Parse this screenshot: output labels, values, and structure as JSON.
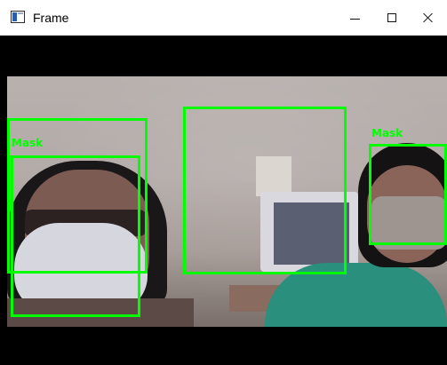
{
  "window": {
    "title": "Frame"
  },
  "controls": {
    "minimize": "minimize",
    "maximize": "maximize",
    "close": "close"
  },
  "detections": [
    {
      "label": "Mask"
    },
    {
      "label": "Mask"
    }
  ],
  "colors": {
    "box": "#00ff00",
    "titlebar": "#ffffff",
    "frame_bg": "#000000"
  }
}
